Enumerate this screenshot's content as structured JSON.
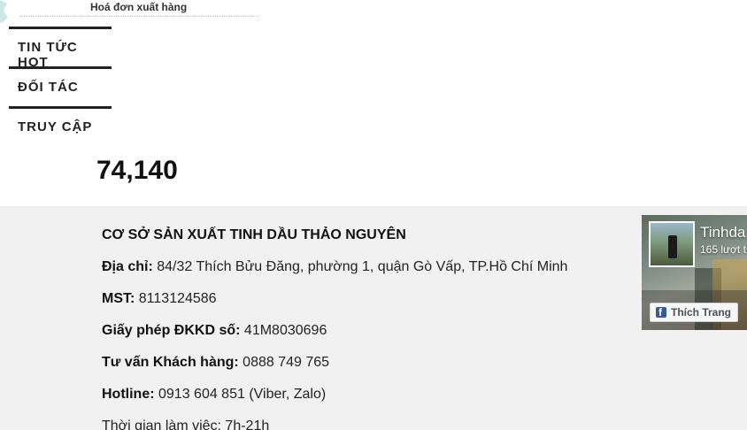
{
  "top_link": {
    "label": "Hoá đơn xuất hàng"
  },
  "sidebar_headings": [
    {
      "label": "TIN TỨC HOT"
    },
    {
      "label": "ĐỐI TÁC"
    },
    {
      "label": "TRUY CẬP"
    }
  ],
  "visit_counter": "74,140",
  "footer": {
    "company_name": "CƠ SỞ SẢN XUẤT TINH DẦU THẢO NGUYÊN",
    "lines": [
      {
        "label": "Địa chỉ:",
        "value": "84/32 Thích Bửu Đăng, phường 1, quận Gò Vấp, TP.Hồ Chí Minh"
      },
      {
        "label": "MST:",
        "value": "8113124586"
      },
      {
        "label": "Giấy phép ĐKKD số:",
        "value": "41M8030696"
      },
      {
        "label": "Tư vấn Khách hàng:",
        "value": "0888 749 765"
      },
      {
        "label": "Hotline:",
        "value": "0913 604 851 (Viber, Zalo)"
      },
      {
        "label": "",
        "value": "Thời gian làm việc: 7h-21h"
      }
    ]
  },
  "facebook_widget": {
    "page_name": "Tinhda",
    "likes_text": "165 lượt t",
    "like_button_label": "Thích Trang",
    "icon": "facebook-icon",
    "brand_color": "#3b5998"
  },
  "colors": {
    "footer_background": "#f1f1f1",
    "heading_rule": "#222222"
  }
}
